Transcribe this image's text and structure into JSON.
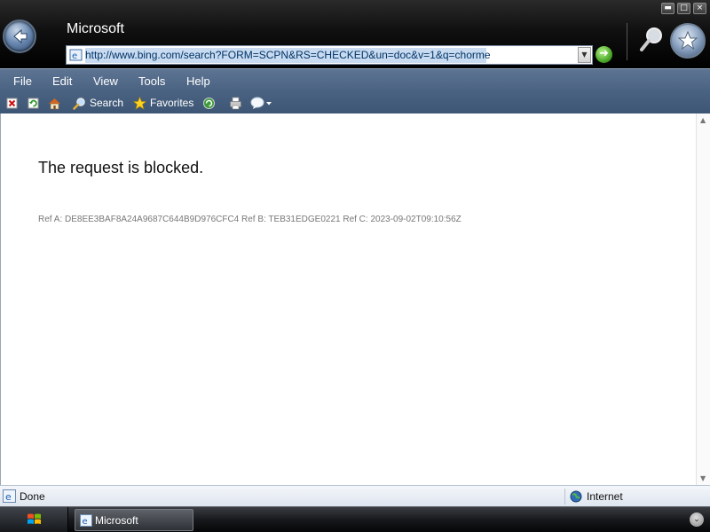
{
  "window": {
    "title": "Microsoft",
    "controls": {
      "minimize": "▬",
      "maximize": "□",
      "close": "×"
    }
  },
  "address_bar": {
    "url": "http://www.bing.com/search?FORM=SCPN&RS=CHECKED&un=doc&v=1&q=chorme"
  },
  "menu": {
    "items": [
      "File",
      "Edit",
      "View",
      "Tools",
      "Help"
    ]
  },
  "command_bar": {
    "search_label": "Search",
    "favorites_label": "Favorites"
  },
  "page": {
    "heading": "The request is blocked.",
    "ref_line": "Ref A: DE8EE3BAF8A24A9687C644B9D976CFC4 Ref B: TEB31EDGE0221 Ref C: 2023-09-02T09:10:56Z"
  },
  "status_bar": {
    "status": "Done",
    "zone": "Internet"
  },
  "taskbar": {
    "task_label": "Microsoft"
  },
  "colors": {
    "toolbar": "#4a6281",
    "accent_go": "#4caa2a",
    "ref_text": "#777777"
  },
  "icons": [
    "back-arrow-icon",
    "page-icon",
    "dropdown-arrow-icon",
    "go-arrow-icon",
    "search-magnifier-icon",
    "favorites-star-icon",
    "stop-icon",
    "refresh-icon",
    "home-icon",
    "add-favorites-icon",
    "print-icon",
    "chat-icon",
    "ie-icon",
    "globe-icon",
    "windows-logo-icon"
  ]
}
